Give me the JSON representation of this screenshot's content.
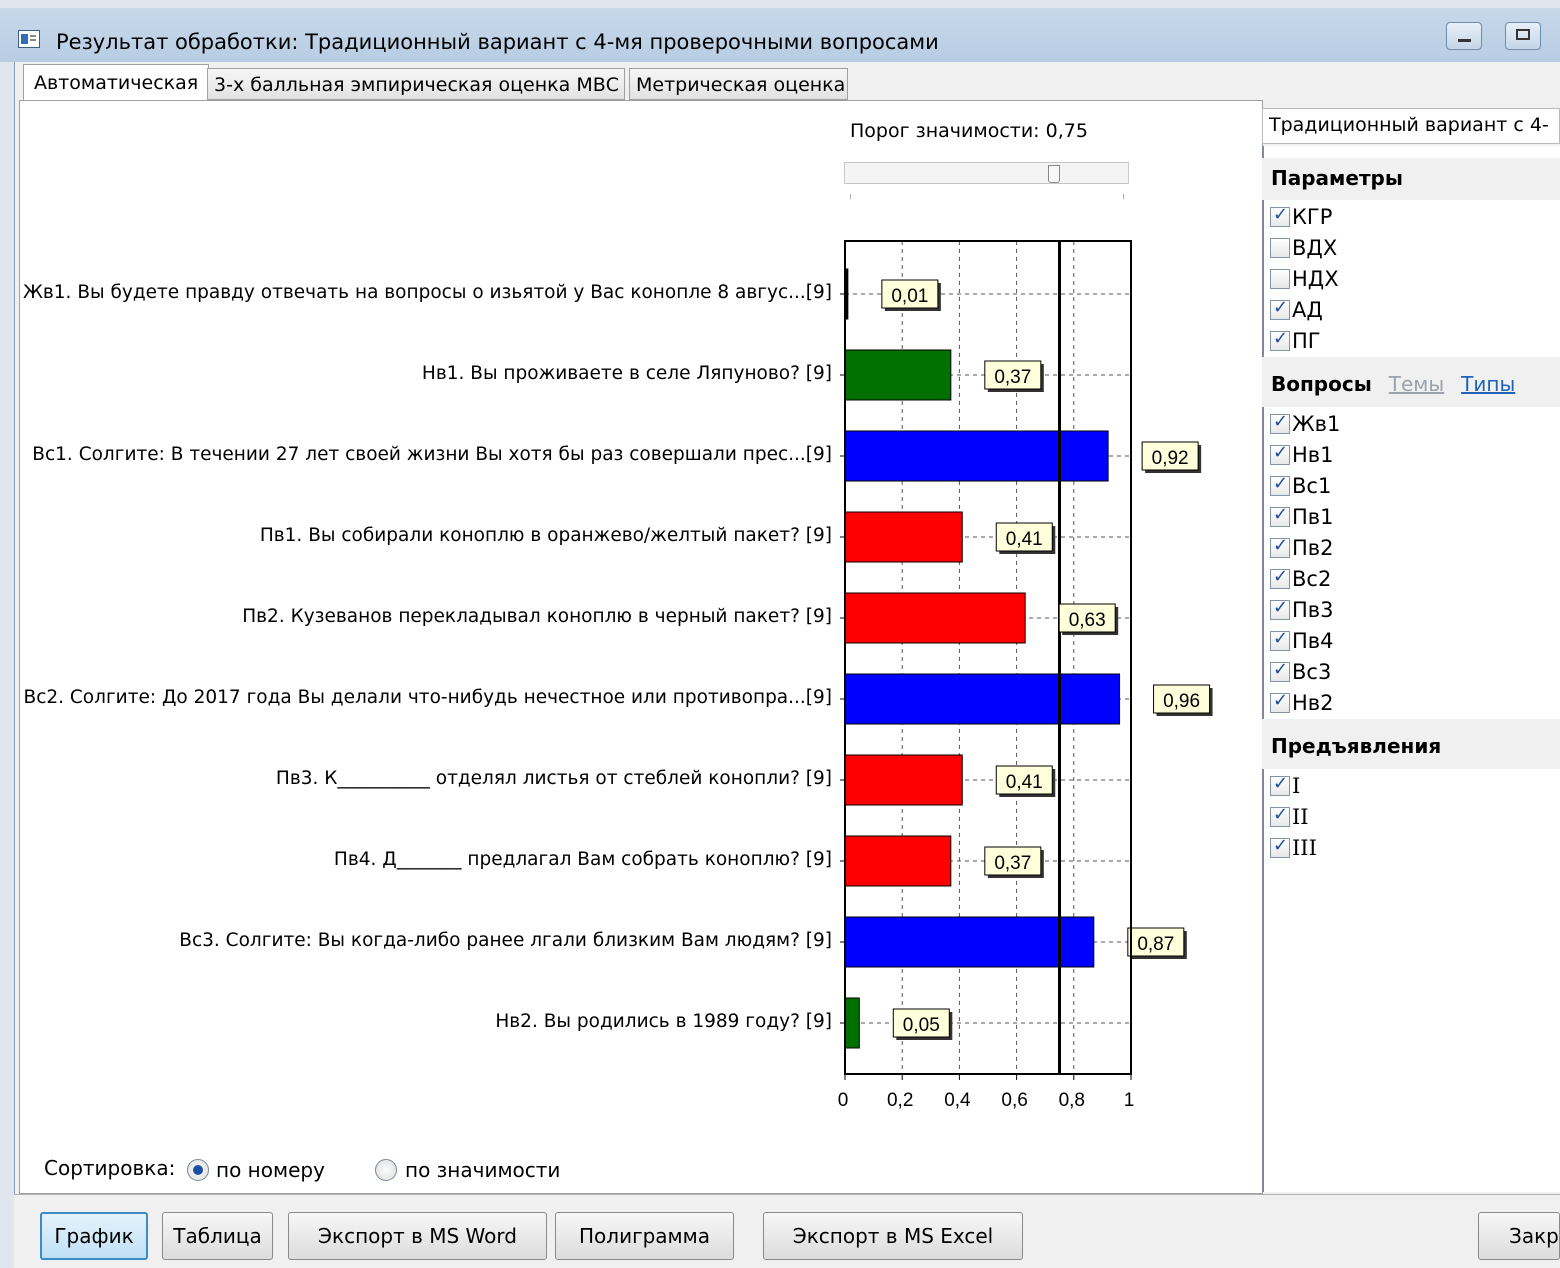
{
  "window": {
    "title": "Результат обработки: Традиционный вариант с 4-мя проверочными вопросами"
  },
  "tabs": [
    "Автоматическая",
    "3-х балльная эмпирическая оценка МВС",
    "Метрическая оценка"
  ],
  "threshold": {
    "label": "Порог значимости: 0,75",
    "value": 0.75
  },
  "chart_data": {
    "type": "bar",
    "orientation": "horizontal",
    "categories": [
      "Жв1. Вы будете правду отвечать на вопросы о изьятой у Вас конопле 8 авгус...[9]",
      "Нв1. Вы проживаете в селе Ляпуново? [9]",
      "Вс1. Солгите: В течении 27 лет своей жизни Вы хотя бы раз совершали прес...[9]",
      "Пв1. Вы собирали коноплю в оранжево/желтый пакет? [9]",
      "Пв2. Кузеванов перекладывал коноплю в черный пакет? [9]",
      "Вс2. Солгите: До 2017 года Вы делали что-нибудь нечестное или противопра...[9]",
      "Пв3. К__________ отделял листья от стеблей конопли? [9]",
      "Пв4. Д_______ предлагал Вам собрать коноплю? [9]",
      "Вс3. Солгите: Вы когда-либо ранее лгали близким Вам людям? [9]",
      "Нв2. Вы родились в 1989 году? [9]"
    ],
    "values": [
      0.01,
      0.37,
      0.92,
      0.41,
      0.63,
      0.96,
      0.41,
      0.37,
      0.87,
      0.05
    ],
    "value_labels": [
      "0,01",
      "0,37",
      "0,92",
      "0,41",
      "0,63",
      "0,96",
      "0,41",
      "0,37",
      "0,87",
      "0,05"
    ],
    "colors": [
      "#000000",
      "#007000",
      "#0000ff",
      "#ff0000",
      "#ff0000",
      "#0000ff",
      "#ff0000",
      "#ff0000",
      "#0000ff",
      "#007000"
    ],
    "xlim": [
      0,
      1
    ],
    "xticks": [
      "0",
      "0,2",
      "0,4",
      "0,6",
      "0,8",
      "1"
    ],
    "threshold_line": 0.75,
    "grid": true
  },
  "sorting": {
    "label": "Сортировка:",
    "options": [
      "по номеру",
      "по значимости"
    ],
    "selected": "по номеру"
  },
  "side": {
    "header": "Традиционный вариант с 4-",
    "params_title": "Параметры",
    "params": [
      {
        "label": "КГР",
        "checked": true
      },
      {
        "label": "ВДХ",
        "checked": false
      },
      {
        "label": "НДХ",
        "checked": false
      },
      {
        "label": "АД",
        "checked": true
      },
      {
        "label": "ПГ",
        "checked": true
      }
    ],
    "questions_title": "Вопросы",
    "themes_link": "Темы",
    "types_link": "Типы",
    "questions": [
      {
        "label": "Жв1",
        "checked": true
      },
      {
        "label": "Нв1",
        "checked": true
      },
      {
        "label": "Вс1",
        "checked": true
      },
      {
        "label": "Пв1",
        "checked": true
      },
      {
        "label": "Пв2",
        "checked": true
      },
      {
        "label": "Вс2",
        "checked": true
      },
      {
        "label": "Пв3",
        "checked": true
      },
      {
        "label": "Пв4",
        "checked": true
      },
      {
        "label": "Вс3",
        "checked": true
      },
      {
        "label": "Нв2",
        "checked": true
      }
    ],
    "presentations_title": "Предъявления",
    "presentations": [
      {
        "label": "I",
        "checked": true
      },
      {
        "label": "II",
        "checked": true
      },
      {
        "label": "III",
        "checked": true
      }
    ]
  },
  "buttons": {
    "chart": "График",
    "table": "Таблица",
    "export_word": "Экспорт в MS Word",
    "polygram": "Полиграмма",
    "export_excel": "Экспорт в MS Excel",
    "close": "Закр"
  }
}
